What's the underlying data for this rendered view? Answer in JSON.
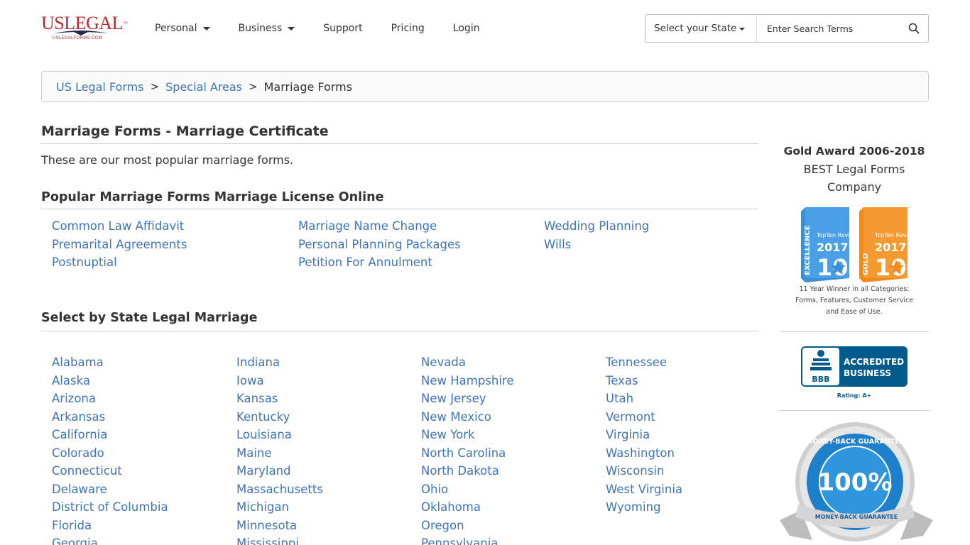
{
  "logo": {
    "text": "USLEGAL",
    "tm": "™",
    "sub": "USLEGALFORMS.COM"
  },
  "nav": [
    {
      "label": "Personal",
      "dropdown": true
    },
    {
      "label": "Business",
      "dropdown": true
    },
    {
      "label": "Support",
      "dropdown": false
    },
    {
      "label": "Pricing",
      "dropdown": false
    },
    {
      "label": "Login",
      "dropdown": false
    }
  ],
  "search": {
    "state_label": "Select your State",
    "placeholder": "Enter Search Terms"
  },
  "breadcrumb": {
    "items": [
      "US Legal Forms",
      "Special Areas"
    ],
    "current": "Marriage Forms",
    "separator": ">"
  },
  "main": {
    "title": "Marriage Forms - Marriage Certificate",
    "intro": "These are our most popular marriage forms.",
    "popular_title": "Popular Marriage Forms Marriage License Online",
    "popular_forms": [
      "Common Law Affidavit",
      "Marriage Name Change",
      "Wedding Planning",
      "Premarital Agreements",
      "Personal Planning Packages",
      "Wills",
      "Postnuptial",
      "Petition For Annulment"
    ],
    "states_title": "Select by State Legal Marriage",
    "states_columns": [
      [
        "Alabama",
        "Alaska",
        "Arizona",
        "Arkansas",
        "California",
        "Colorado",
        "Connecticut",
        "Delaware",
        "District of Columbia",
        "Florida",
        "Georgia"
      ],
      [
        "Indiana",
        "Iowa",
        "Kansas",
        "Kentucky",
        "Louisiana",
        "Maine",
        "Maryland",
        "Massachusetts",
        "Michigan",
        "Minnesota",
        "Mississippi"
      ],
      [
        "Nevada",
        "New Hampshire",
        "New Jersey",
        "New Mexico",
        "New York",
        "North Carolina",
        "North Dakota",
        "Ohio",
        "Oklahoma",
        "Oregon",
        "Pennsylvania"
      ],
      [
        "Tennessee",
        "Texas",
        "Utah",
        "Vermont",
        "Virginia",
        "Washington",
        "Wisconsin",
        "West Virginia",
        "Wyoming"
      ]
    ]
  },
  "sidebar": {
    "award_title": "Gold Award 2006-2018",
    "award_sub": "BEST Legal Forms Company",
    "badge1": {
      "brand": "TopTen Reviews",
      "year": "2017",
      "word": "EXCELLENCE",
      "color": "#3a8fd6"
    },
    "badge2": {
      "brand": "TopTen Reviews",
      "year": "2017",
      "word": "GOLD",
      "color": "#f08a1c"
    },
    "winner_text": "11 Year Winner in all Categories: Forms, Features, Customer Service and Ease of Use.",
    "bbb": {
      "line1": "ACCREDITED",
      "line2": "BUSINESS",
      "logo": "BBB",
      "rating": "Rating: A+",
      "color": "#005a8c"
    },
    "guarantee": {
      "percent": "100%",
      "ring_text": "MONEY-BACK GUARANTEE",
      "ribbon_text": "MONEY-BACK GUARANTEE",
      "color": "#1e7fcb"
    }
  },
  "colors": {
    "link": "#3f74b8",
    "logo_red": "#c1272d"
  }
}
